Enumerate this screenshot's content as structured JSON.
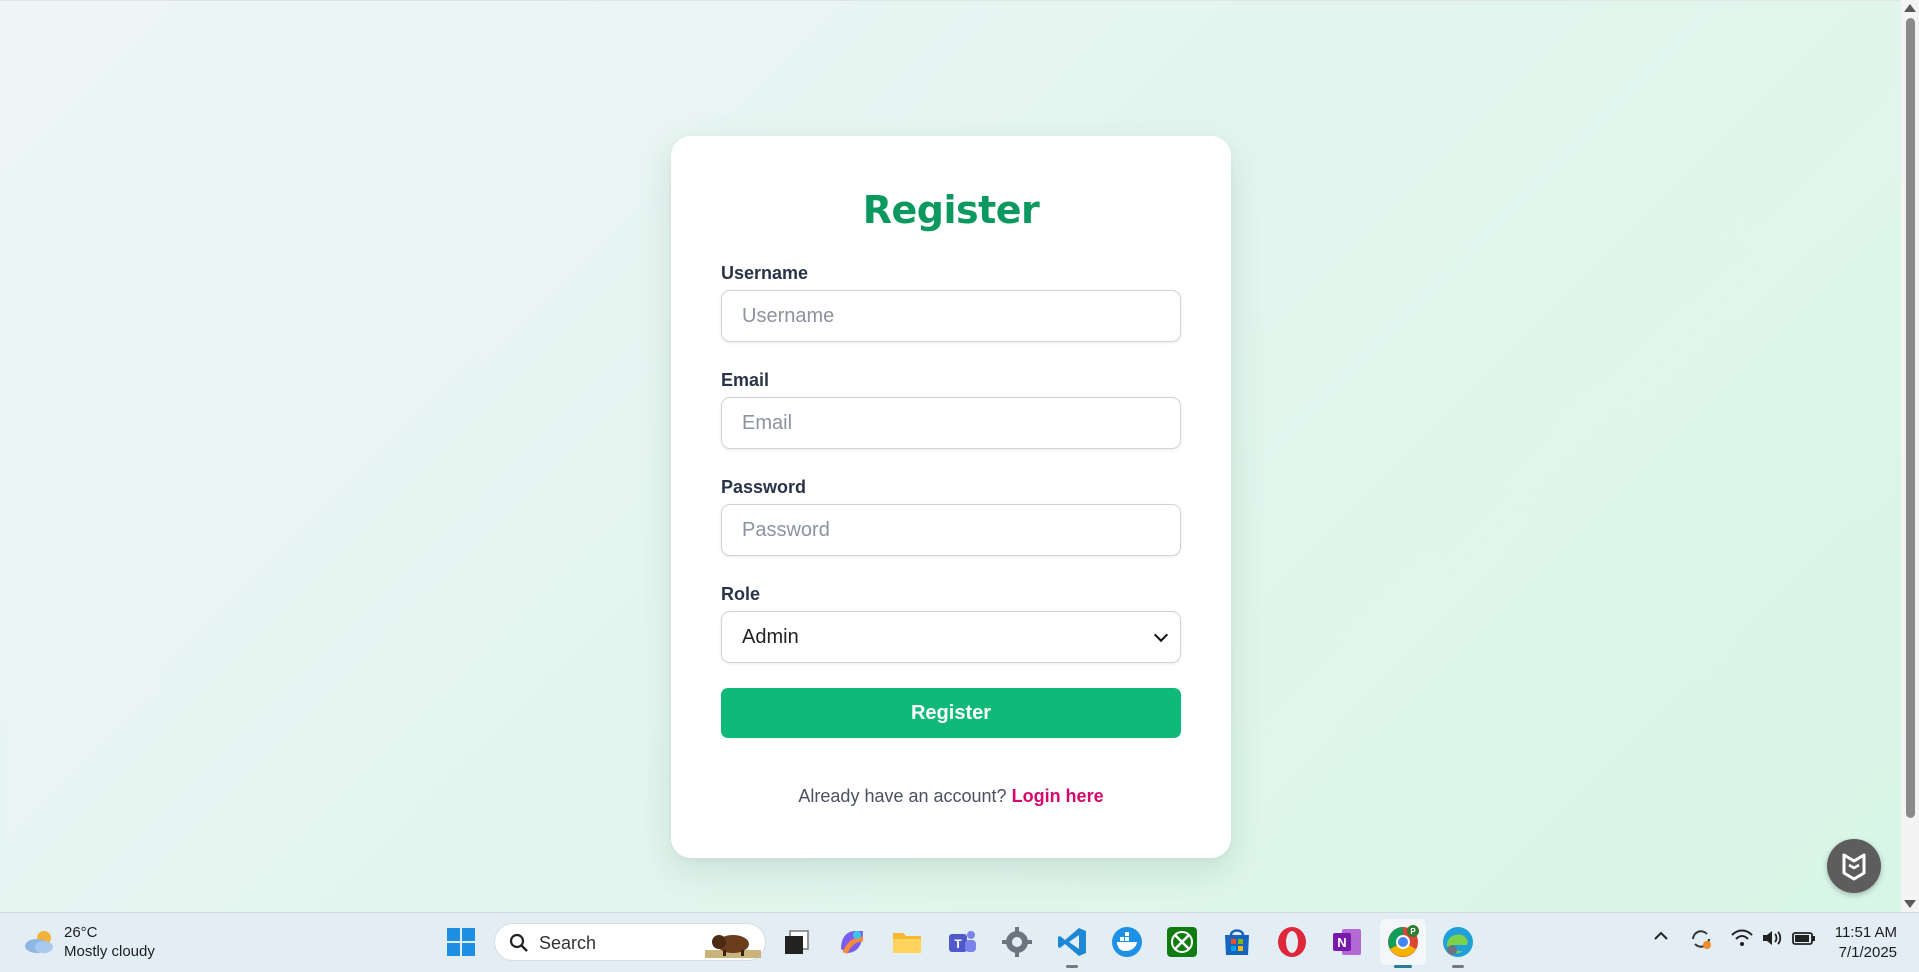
{
  "form": {
    "title": "Register",
    "username_label": "Username",
    "username_placeholder": "Username",
    "email_label": "Email",
    "email_placeholder": "Email",
    "password_label": "Password",
    "password_placeholder": "Password",
    "role_label": "Role",
    "role_value": "Admin",
    "submit_label": "Register",
    "footer_text": "Already have an account?",
    "login_link": "Login here"
  },
  "taskbar": {
    "weather_temp": "26°C",
    "weather_desc": "Mostly cloudy",
    "search_label": "Search",
    "time": "11:51 AM",
    "date": "7/1/2025"
  },
  "colors": {
    "title": "#0b9960",
    "button": "#0fba78",
    "link": "#d6086c"
  }
}
